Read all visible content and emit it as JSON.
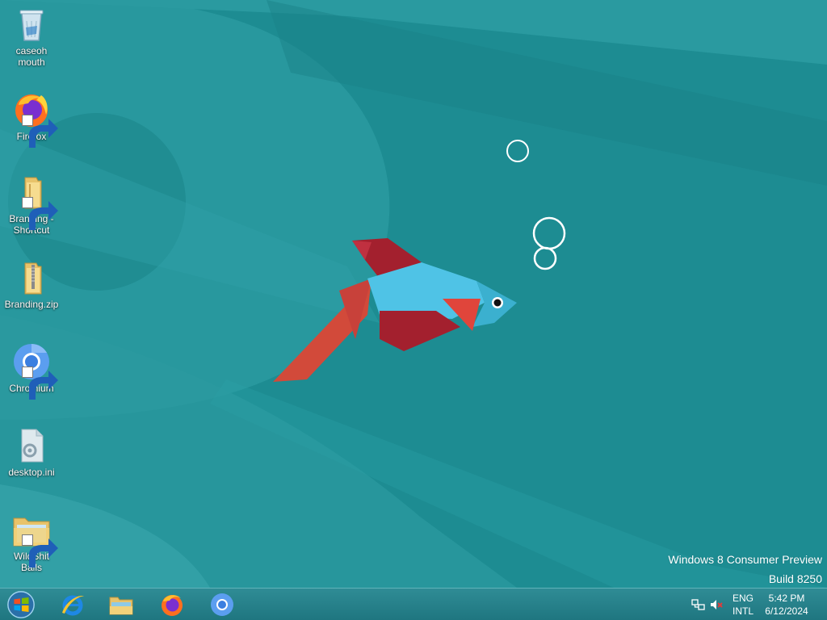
{
  "desktop": {
    "icons": [
      {
        "label": "caseoh mouth",
        "icon": "recycle-bin-icon"
      },
      {
        "label": "Firefox",
        "icon": "firefox-icon"
      },
      {
        "label": "Branding - Shortcut",
        "icon": "folder-shortcut-icon"
      },
      {
        "label": "Branding.zip",
        "icon": "zip-folder-icon"
      },
      {
        "label": "Chromium",
        "icon": "chromium-icon"
      },
      {
        "label": "desktop.ini",
        "icon": "settings-file-icon"
      },
      {
        "label": "WildShit Balls",
        "icon": "folder-shortcut-icon"
      }
    ]
  },
  "watermark": {
    "line1": "Windows 8 Consumer Preview",
    "line2": "Build 8250"
  },
  "taskbar": {
    "start_icon": "windows-start-orb-icon",
    "pinned": [
      {
        "name": "Internet Explorer",
        "icon": "internet-explorer-icon"
      },
      {
        "name": "File Explorer",
        "icon": "file-explorer-icon"
      },
      {
        "name": "Firefox",
        "icon": "firefox-icon"
      },
      {
        "name": "Chromium",
        "icon": "chromium-icon"
      }
    ],
    "tray": {
      "network_icon": "network-icon",
      "volume_icon": "volume-muted-icon",
      "lang_top": "ENG",
      "lang_bottom": "INTL",
      "time": "5:42 PM",
      "date": "6/12/2024"
    }
  },
  "colors": {
    "wallpaper": "#1d8c92",
    "fish_body": "#4fc3e6",
    "fish_fin_red": "#a3202e",
    "fish_tail": "#d24a3a"
  }
}
